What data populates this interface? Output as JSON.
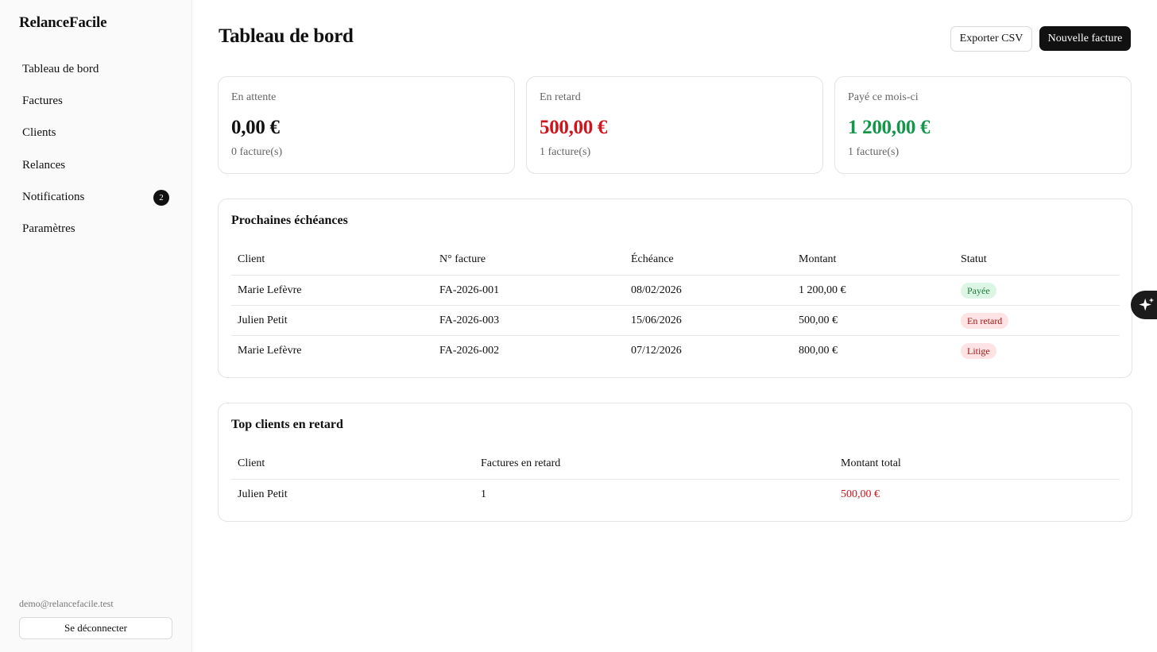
{
  "app": {
    "brand": "RelanceFacile"
  },
  "sidebar": {
    "items": [
      {
        "label": "Tableau de bord"
      },
      {
        "label": "Factures"
      },
      {
        "label": "Clients"
      },
      {
        "label": "Relances"
      },
      {
        "label": "Notifications",
        "badge": "2"
      },
      {
        "label": "Paramètres"
      }
    ],
    "user_email": "demo@relancefacile.test",
    "logout_label": "Se déconnecter"
  },
  "header": {
    "title": "Tableau de bord",
    "export_label": "Exporter CSV",
    "new_invoice_label": "Nouvelle facture"
  },
  "kpis": [
    {
      "label": "En attente",
      "value": "0,00 €",
      "sub": "0 facture(s)",
      "color": "#111111"
    },
    {
      "label": "En retard",
      "value": "500,00 €",
      "sub": "1 facture(s)",
      "color": "#d0141c"
    },
    {
      "label": "Payé ce mois-ci",
      "value": "1 200,00 €",
      "sub": "1 facture(s)",
      "color": "#13964a"
    }
  ],
  "upcoming": {
    "title": "Prochaines échéances",
    "columns": [
      "Client",
      "N° facture",
      "Échéance",
      "Montant",
      "Statut"
    ],
    "rows": [
      {
        "client": "Marie Lefèvre",
        "number": "FA-2026-001",
        "due": "08/02/2026",
        "amount": "1 200,00 €",
        "status": "Payée",
        "status_kind": "green"
      },
      {
        "client": "Julien Petit",
        "number": "FA-2026-003",
        "due": "15/06/2026",
        "amount": "500,00 €",
        "status": "En retard",
        "status_kind": "red"
      },
      {
        "client": "Marie Lefèvre",
        "number": "FA-2026-002",
        "due": "07/12/2026",
        "amount": "800,00 €",
        "status": "Litige",
        "status_kind": "red"
      }
    ]
  },
  "top_late": {
    "title": "Top clients en retard",
    "columns": [
      "Client",
      "Factures en retard",
      "Montant total"
    ],
    "rows": [
      {
        "client": "Julien Petit",
        "count": "1",
        "total": "500,00 €"
      }
    ]
  },
  "colors": {
    "danger": "#d0141c",
    "success": "#13964a",
    "accent": "#111111"
  },
  "icons": {
    "floating_assistant": "sparkle-icon"
  }
}
